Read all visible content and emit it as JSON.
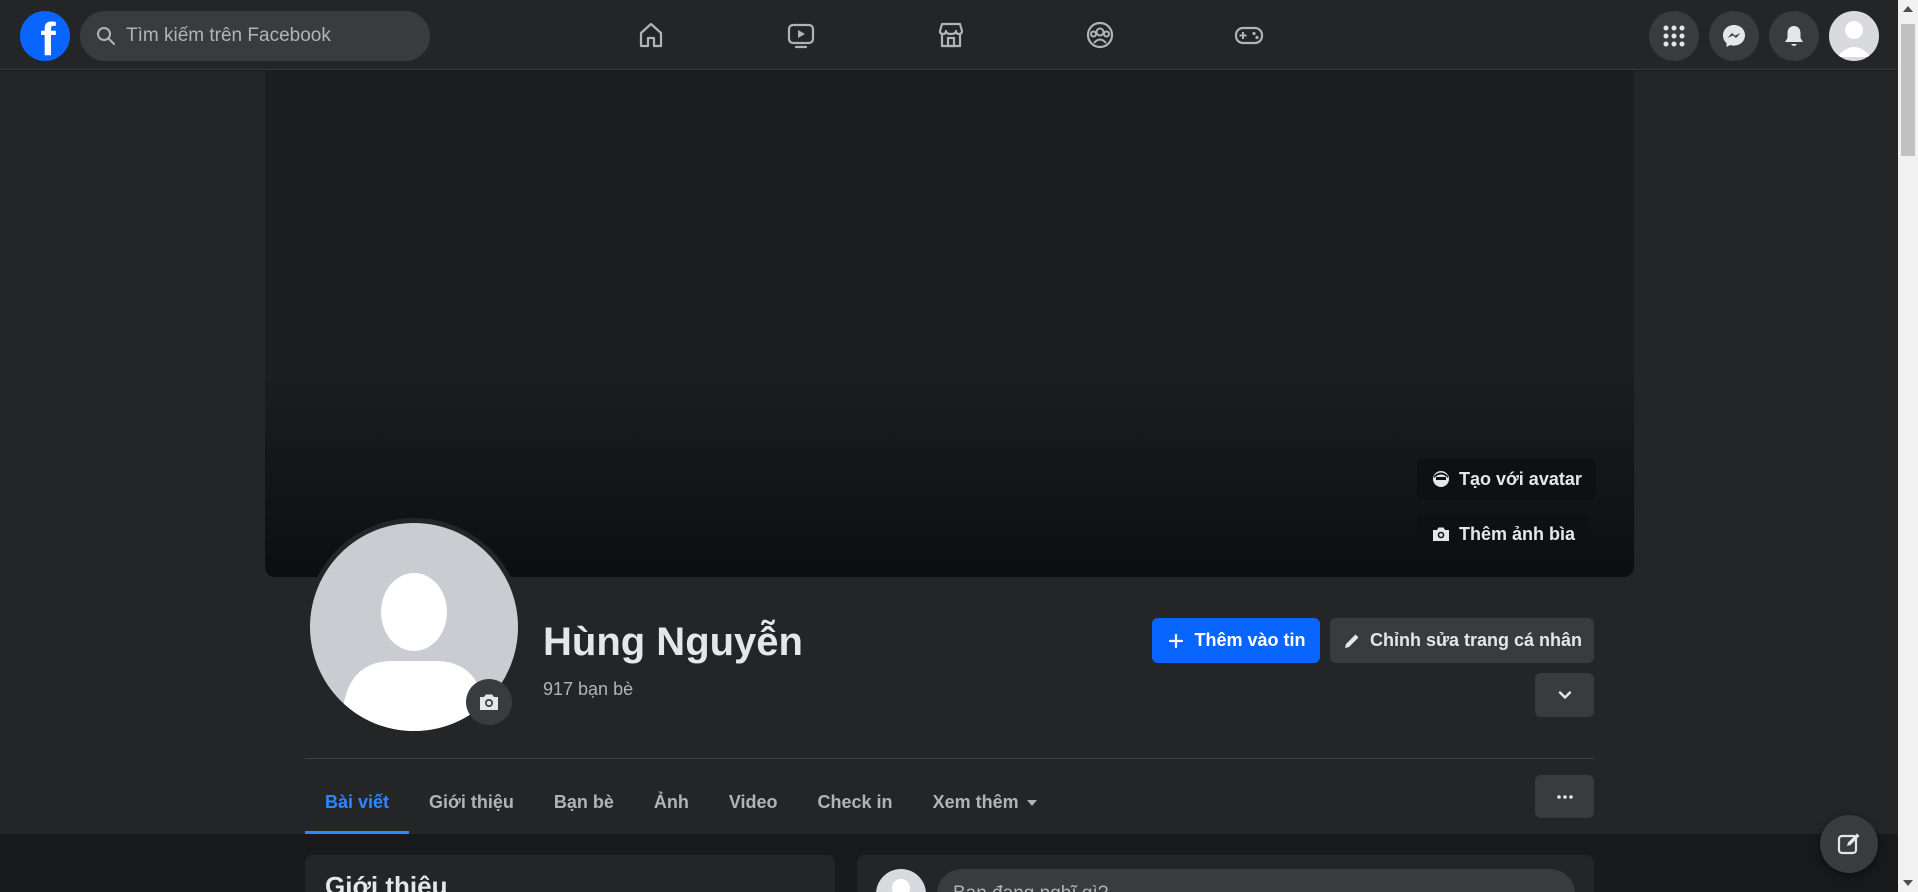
{
  "topbar": {
    "logo": "facebook-logo",
    "search": {
      "placeholder": "Tìm kiếm trên Facebook"
    },
    "nav_icons": [
      "home-icon",
      "video-icon",
      "marketplace-icon",
      "groups-icon",
      "gaming-icon"
    ],
    "right_icons": [
      "menu-grid-icon",
      "messenger-icon",
      "notifications-icon",
      "account-avatar"
    ]
  },
  "cover": {
    "avatar_button": "Tạo với avatar",
    "cover_button": "Thêm ảnh bìa"
  },
  "profile": {
    "name": "Hùng Nguyễn",
    "friends": "917 bạn bè",
    "add_story": "Thêm vào tin",
    "edit_profile": "Chỉnh sửa trang cá nhân"
  },
  "tabs": [
    {
      "label": "Bài viết",
      "active": true
    },
    {
      "label": "Giới thiệu"
    },
    {
      "label": "Bạn bè"
    },
    {
      "label": "Ảnh"
    },
    {
      "label": "Video"
    },
    {
      "label": "Check in"
    },
    {
      "label": "Xem thêm"
    }
  ],
  "intro": {
    "title": "Giới thiệu"
  },
  "composer": {
    "placeholder": "Bạn đang nghĩ gì?"
  },
  "colors": {
    "accent": "#0866ff",
    "tab_active": "#2d88ff",
    "surface": "#242526",
    "background": "#18191a"
  }
}
